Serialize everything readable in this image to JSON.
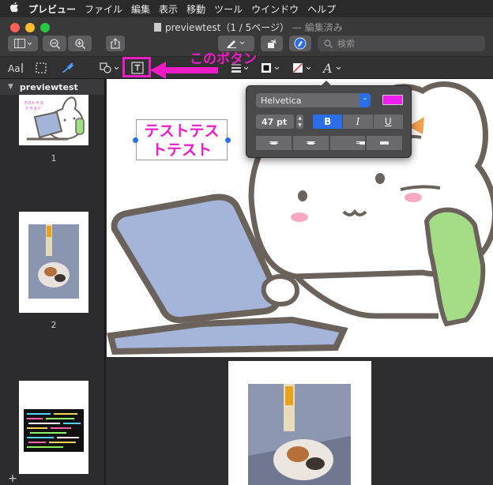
{
  "menubar": {
    "apple": "",
    "items": [
      "プレビュー",
      "ファイル",
      "編集",
      "表示",
      "移動",
      "ツール",
      "ウインドウ",
      "ヘルプ"
    ]
  },
  "window": {
    "title": "previewtest（1 / 5ページ）",
    "subtitle": "— 編集済み",
    "search_placeholder": "検索"
  },
  "sidebar": {
    "header": "previewtest",
    "pages": [
      "1",
      "2"
    ]
  },
  "page1": {
    "textbox_line1": "テストテス",
    "textbox_line2": "トテスト"
  },
  "popover": {
    "font": "Helvetica",
    "size": "47 pt",
    "bold": "B",
    "italic": "I",
    "underline": "U",
    "text_color": "#f01ef0",
    "alignment": "center"
  },
  "annotation": {
    "label": "このボタン",
    "color": "#ee1cc7"
  }
}
